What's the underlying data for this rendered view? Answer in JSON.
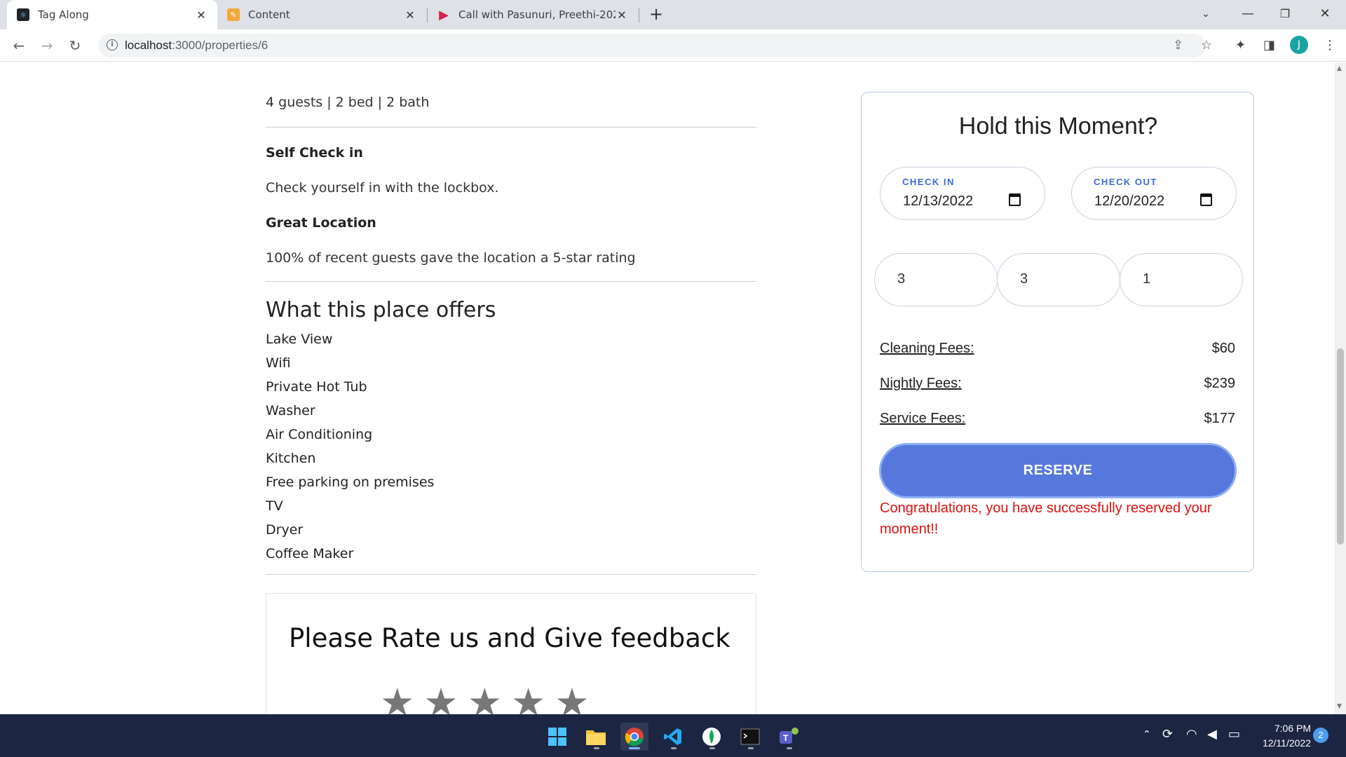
{
  "browser": {
    "tabs": [
      {
        "title": "Tag Along",
        "active": true,
        "favicon": "react-icon"
      },
      {
        "title": "Content",
        "active": false,
        "favicon": "pencil-icon"
      },
      {
        "title": "Call with Pasunuri, Preethi-20221",
        "active": false,
        "favicon": "media-play-icon"
      }
    ],
    "url_host": "localhost",
    "url_path": ":3000/properties/6",
    "profile_initial": "J"
  },
  "listing": {
    "guests_line": "4 guests | 2 bed | 2 bath",
    "features": [
      {
        "title": "Self Check in",
        "description": "Check yourself in with the lockbox."
      },
      {
        "title": "Great Location",
        "description": "100% of recent guests gave the location a 5-star rating"
      }
    ],
    "offers_heading": "What this place offers",
    "amenities": [
      "Lake View",
      "Wifi",
      "Private Hot Tub",
      "Washer",
      "Air Conditioning",
      "Kitchen",
      "Free parking on premises",
      "TV",
      "Dryer",
      "Coffee Maker"
    ],
    "feedback_title": "Please Rate us and Give feedback",
    "stars": 5
  },
  "booking": {
    "title": "Hold this Moment?",
    "check_in_label": "CHECK IN",
    "check_in_value": "12/13/2022",
    "check_out_label": "CHECK OUT",
    "check_out_value": "12/20/2022",
    "numbers": [
      "3",
      "3",
      "1"
    ],
    "fees": [
      {
        "label": "Cleaning Fees:",
        "value": "$60"
      },
      {
        "label": "Nightly Fees:",
        "value": "$239"
      },
      {
        "label": "Service Fees:",
        "value": "$177"
      }
    ],
    "reserve_label": "RESERVE",
    "confirmation": "Congratulations, you have successfully reserved your moment!!"
  },
  "taskbar": {
    "time": "7:06 PM",
    "date": "12/11/2022",
    "notification_count": "2"
  },
  "colors": {
    "accent": "#5678dd",
    "label_blue": "#3d6ad6",
    "confirm_red": "#dd1111",
    "taskbar": "#1c2541"
  }
}
